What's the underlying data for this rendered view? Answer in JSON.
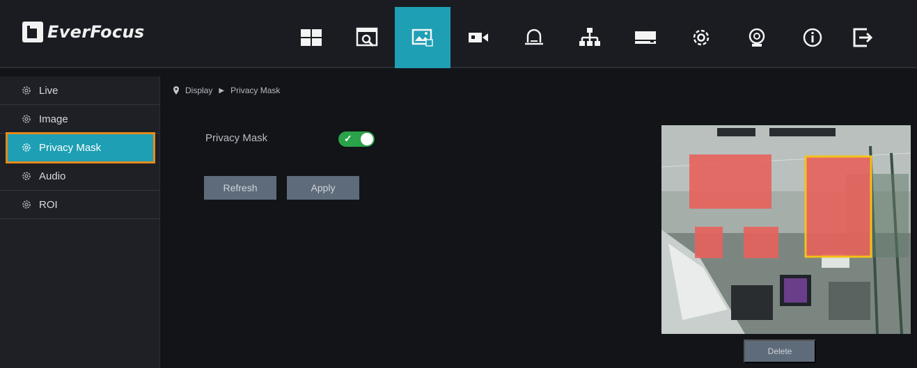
{
  "app": {
    "brand": "EverFocus"
  },
  "nav": {
    "items": [
      {
        "icon": "live-view-icon"
      },
      {
        "icon": "playback-icon"
      },
      {
        "icon": "display-icon",
        "active": true
      },
      {
        "icon": "camera-icon"
      },
      {
        "icon": "alarm-icon"
      },
      {
        "icon": "network-icon"
      },
      {
        "icon": "storage-icon"
      },
      {
        "icon": "system-settings-icon"
      },
      {
        "icon": "maintenance-icon"
      },
      {
        "icon": "info-icon"
      },
      {
        "icon": "logout-icon"
      }
    ],
    "accent_color": "#1e9fb4"
  },
  "sidebar": {
    "items": [
      {
        "label": "Live",
        "icon": "gear-icon"
      },
      {
        "label": "Image",
        "icon": "gear-icon"
      },
      {
        "label": "Privacy Mask",
        "icon": "gear-icon",
        "active": true
      },
      {
        "label": "Audio",
        "icon": "gear-icon"
      },
      {
        "label": "ROI",
        "icon": "gear-icon"
      }
    ],
    "highlight_color": "#e58a1c"
  },
  "breadcrumb": {
    "root": "Display",
    "current": "Privacy Mask"
  },
  "privacy_mask": {
    "label": "Privacy Mask",
    "enabled": true,
    "toggle_color": "#2aa24a"
  },
  "buttons": {
    "refresh": "Refresh",
    "apply": "Apply",
    "delete": "Delete"
  },
  "preview": {
    "mask_color": "#e8625c",
    "selected_mask_color": "#f2c21a"
  }
}
